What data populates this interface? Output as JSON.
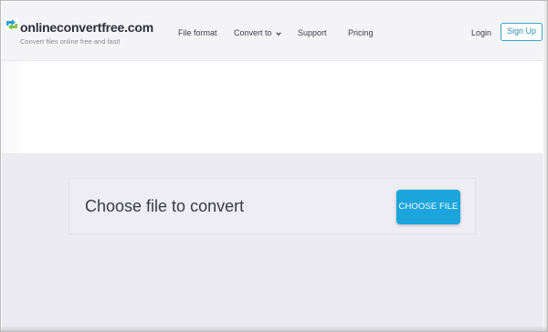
{
  "header": {
    "logo": {
      "title": "onlineconvertfree.com",
      "tagline": "Convert files online free and fast!",
      "icon": "convert-arrows-icon"
    },
    "nav": {
      "file_format": "File format",
      "convert_to": "Convert to",
      "support": "Support",
      "pricing": "Pricing"
    },
    "login": "Login",
    "signup": "Sign Up"
  },
  "upload": {
    "label": "Choose file to convert",
    "button": "CHOOSE FILE"
  },
  "colors": {
    "accent": "#1ca5dc",
    "signup_border": "#33a5c9",
    "logo_green": "#7dc242",
    "logo_blue": "#2b9fd7"
  }
}
